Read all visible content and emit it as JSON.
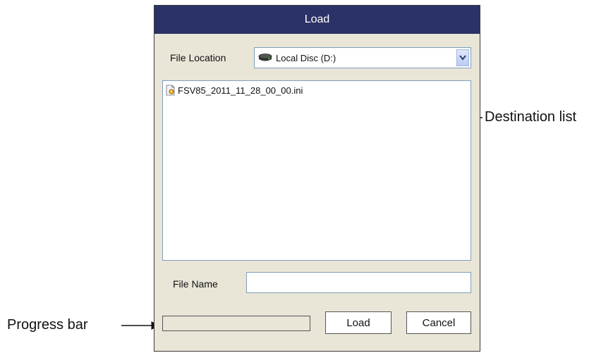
{
  "dialog": {
    "title": "Load",
    "file_location_label": "File Location",
    "file_location_value": "Local Disc (D:)",
    "files": [
      {
        "name": "FSV85_2011_11_28_00_00.ini",
        "icon": "ini-file-icon"
      }
    ],
    "file_name_label": "File Name",
    "file_name_value": "",
    "progress": 0,
    "load_button": "Load",
    "cancel_button": "Cancel"
  },
  "callouts": {
    "destination_list": "Destination list",
    "progress_bar": "Progress bar"
  },
  "colors": {
    "titlebar": "#2b3267",
    "dialog_bg": "#e9e6d8",
    "field_border": "#7f9db9"
  }
}
